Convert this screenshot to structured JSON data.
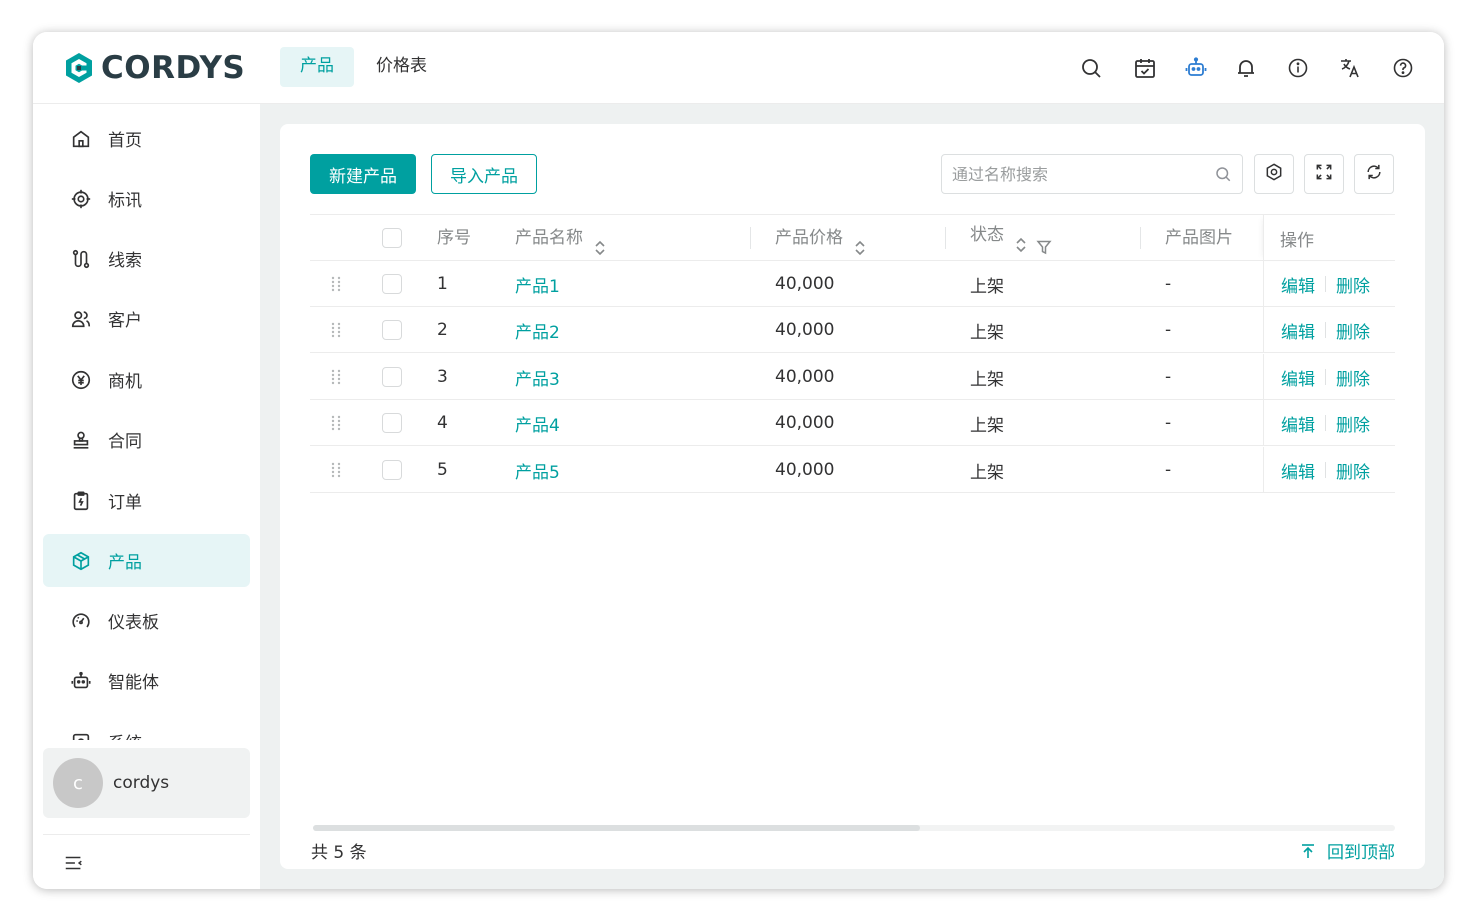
{
  "app": {
    "brand": "CORDYS",
    "accent_color": "#00a0a0"
  },
  "top_tabs": [
    {
      "label": "产品",
      "active": true
    },
    {
      "label": "价格表",
      "active": false
    }
  ],
  "top_icons": [
    "search-icon",
    "calendar-check-icon",
    "robot-icon",
    "bell-icon",
    "info-icon",
    "translate-icon",
    "help-icon"
  ],
  "sidebar": {
    "items": [
      {
        "label": "首页",
        "icon": "home-icon"
      },
      {
        "label": "标讯",
        "icon": "target-icon"
      },
      {
        "label": "线索",
        "icon": "route-icon"
      },
      {
        "label": "客户",
        "icon": "users-icon"
      },
      {
        "label": "商机",
        "icon": "yen-icon"
      },
      {
        "label": "合同",
        "icon": "stamp-icon"
      },
      {
        "label": "订单",
        "icon": "clipboard-icon"
      },
      {
        "label": "产品",
        "icon": "box-icon",
        "active": true
      },
      {
        "label": "仪表板",
        "icon": "gauge-icon"
      },
      {
        "label": "智能体",
        "icon": "robot-icon"
      },
      {
        "label": "系统",
        "icon": "settings-icon"
      }
    ],
    "user": {
      "avatar_letter": "c",
      "name": "cordys"
    }
  },
  "toolbar": {
    "new_label": "新建产品",
    "import_label": "导入产品",
    "search_placeholder": "通过名称搜索"
  },
  "table": {
    "columns": {
      "index": "序号",
      "name": "产品名称",
      "price": "产品价格",
      "status": "状态",
      "image": "产品图片",
      "ops": "操作"
    },
    "rows": [
      {
        "index": "1",
        "name": "产品1",
        "price": "40,000",
        "status": "上架",
        "image": "-",
        "edit": "编辑",
        "delete": "删除"
      },
      {
        "index": "2",
        "name": "产品2",
        "price": "40,000",
        "status": "上架",
        "image": "-",
        "edit": "编辑",
        "delete": "删除"
      },
      {
        "index": "3",
        "name": "产品3",
        "price": "40,000",
        "status": "上架",
        "image": "-",
        "edit": "编辑",
        "delete": "删除"
      },
      {
        "index": "4",
        "name": "产品4",
        "price": "40,000",
        "status": "上架",
        "image": "-",
        "edit": "编辑",
        "delete": "删除"
      },
      {
        "index": "5",
        "name": "产品5",
        "price": "40,000",
        "status": "上架",
        "image": "-",
        "edit": "编辑",
        "delete": "删除"
      }
    ]
  },
  "footer": {
    "total": "共 5 条",
    "back_to_top": "回到顶部"
  }
}
